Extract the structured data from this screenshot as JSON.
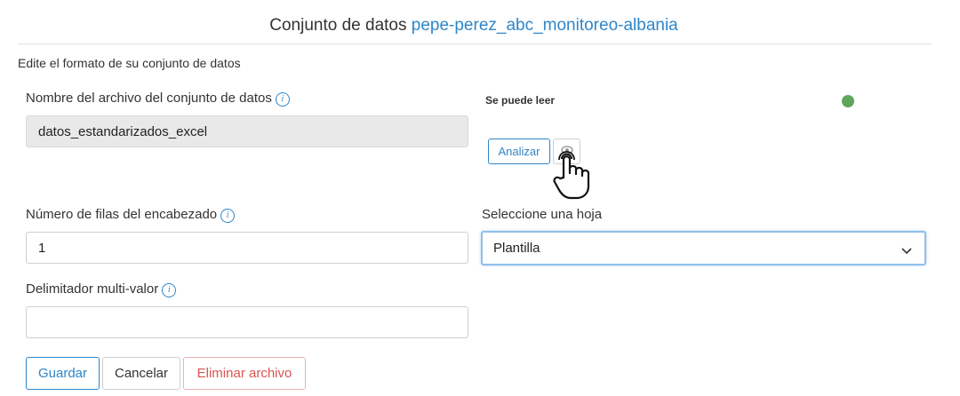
{
  "header": {
    "title_prefix": "Conjunto de datos",
    "dataset_name": "pepe-perez_abc_monitoreo-albania"
  },
  "form": {
    "subtitle": "Edite el formato de su conjunto de datos",
    "filename": {
      "label": "Nombre del archivo del conjunto de datos",
      "value": "datos_estandarizados_excel"
    },
    "status": {
      "label": "Se puede leer",
      "color": "#5ea55e"
    },
    "analyze_button": "Analizar",
    "header_rows": {
      "label": "Número de filas del encabezado",
      "value": "1"
    },
    "sheet": {
      "label": "Seleccione una hoja",
      "selected": "Plantilla"
    },
    "delimiter": {
      "label": "Delimitador multi-valor",
      "value": ""
    },
    "info_glyph": "i",
    "buttons": {
      "save": "Guardar",
      "cancel": "Cancelar",
      "delete": "Eliminar archivo"
    }
  },
  "icons": [
    "info-icon",
    "eye-icon",
    "chevron-down-icon",
    "hand-pointer-cursor-icon"
  ]
}
